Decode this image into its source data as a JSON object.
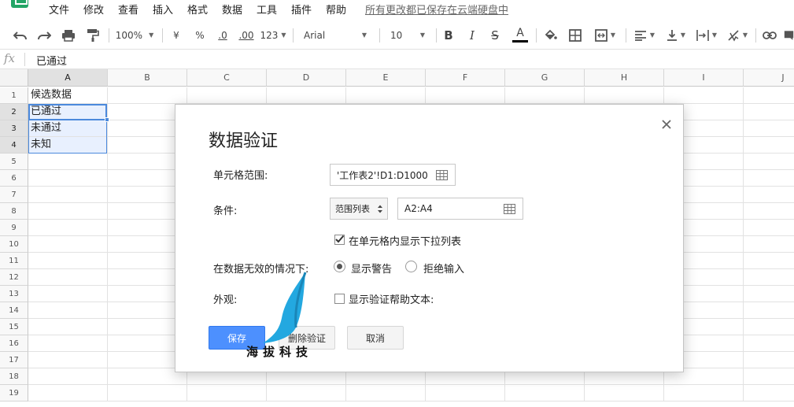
{
  "menu": {
    "items": [
      "文件",
      "修改",
      "查看",
      "插入",
      "格式",
      "数据",
      "工具",
      "插件",
      "帮助"
    ],
    "save_status": "所有更改都已保存在云端硬盘中"
  },
  "toolbar": {
    "zoom": "100%",
    "currency": "¥",
    "percent": "%",
    "decrease_decimals": ".0",
    "increase_decimals": ".00",
    "more_formats": "123",
    "font_family": "Arial",
    "font_size": "10",
    "bold": "B",
    "italic": "I",
    "strikethrough": "S",
    "text_color_label": "A",
    "text_color": "#000000"
  },
  "formula_bar": {
    "fx": "fx",
    "value": "已通过"
  },
  "grid": {
    "columns": [
      "A",
      "B",
      "C",
      "D",
      "E",
      "F",
      "G",
      "H",
      "I",
      "J"
    ],
    "selected_column": "A",
    "rows": [
      "1",
      "2",
      "3",
      "4",
      "5",
      "6",
      "7",
      "8",
      "9",
      "10",
      "11",
      "12",
      "13",
      "14",
      "15",
      "16",
      "17",
      "18",
      "19"
    ],
    "selected_rows": [
      "2",
      "3",
      "4"
    ],
    "cells": {
      "A1": "候选数据",
      "A2": "已通过",
      "A3": "未通过",
      "A4": "未知"
    },
    "selection_color": "#4b89dc"
  },
  "dialog": {
    "title": "数据验证",
    "cell_range_label": "单元格范围:",
    "cell_range_value": "'工作表2'!D1:D1000",
    "criteria_label": "条件:",
    "criteria_type": "范围列表",
    "criteria_value": "A2:A4",
    "show_dropdown_label": "在单元格内显示下拉列表",
    "show_dropdown_checked": true,
    "invalid_label": "在数据无效的情况下:",
    "invalid_options": [
      "显示警告",
      "拒绝输入"
    ],
    "invalid_selected": "显示警告",
    "appearance_label": "外观:",
    "help_text_label": "显示验证帮助文本:",
    "help_text_checked": false,
    "save_button": "保存",
    "delete_button": "删除验证",
    "cancel_button": "取消",
    "primary_color": "#4d90fe"
  },
  "watermark": {
    "text": "海拔科技",
    "color": "#23a8e0"
  }
}
